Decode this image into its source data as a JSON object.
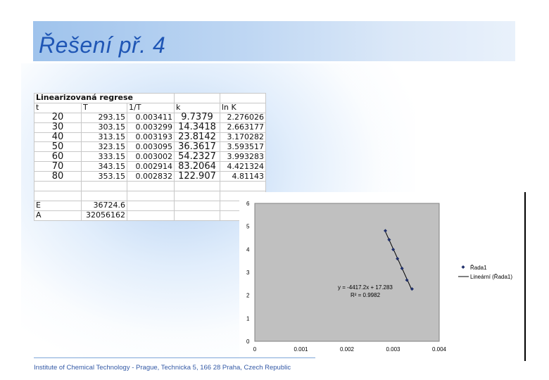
{
  "slide": {
    "title": "Řešení př. 4",
    "footer": "Institute of Chemical Technology - Prague, Technicka 5, 166 28 Praha, Czech Republic"
  },
  "sheet": {
    "title": "Linearizovaná regrese",
    "headers": [
      "t",
      "T",
      "1/T",
      "k",
      "ln K"
    ],
    "rows": [
      [
        "20",
        "293.15",
        "0.003411",
        "9.7379",
        "2.276026"
      ],
      [
        "30",
        "303.15",
        "0.003299",
        "14.3418",
        "2.663177"
      ],
      [
        "40",
        "313.15",
        "0.003193",
        "23.8142",
        "3.170282"
      ],
      [
        "50",
        "323.15",
        "0.003095",
        "36.3617",
        "3.593517"
      ],
      [
        "60",
        "333.15",
        "0.003002",
        "54.2327",
        "3.993283"
      ],
      [
        "70",
        "343.15",
        "0.002914",
        "83.2064",
        "4.421324"
      ],
      [
        "80",
        "353.15",
        "0.002832",
        "122.907",
        "4.81143"
      ]
    ],
    "E_label": "E",
    "E_value": "36724.6",
    "A_label": "A",
    "A_value": "32056162"
  },
  "chart_data": {
    "type": "scatter",
    "x": [
      0.003411,
      0.003299,
      0.003193,
      0.003095,
      0.003002,
      0.002914,
      0.002832
    ],
    "y": [
      2.276026,
      2.663177,
      3.170282,
      3.593517,
      3.993283,
      4.421324,
      4.81143
    ],
    "xlim": [
      0,
      0.004
    ],
    "ylim": [
      0,
      6
    ],
    "x_ticks": [
      "0",
      "0.001",
      "0.002",
      "0.003",
      "0.004"
    ],
    "y_ticks": [
      "0",
      "1",
      "2",
      "3",
      "4",
      "5",
      "6"
    ],
    "series_name": "Řada1",
    "trendline_name": "Lineární (Řada1)",
    "equation": "y = -4417.2x + 17.283",
    "r2": "R² = 0.9982",
    "slope": -4417.2,
    "intercept": 17.283,
    "grid": false,
    "legend_position": "right",
    "colors": {
      "plot_bg": "#c0c0c0",
      "marker": "#1f2f6b",
      "line": "#000000"
    }
  }
}
